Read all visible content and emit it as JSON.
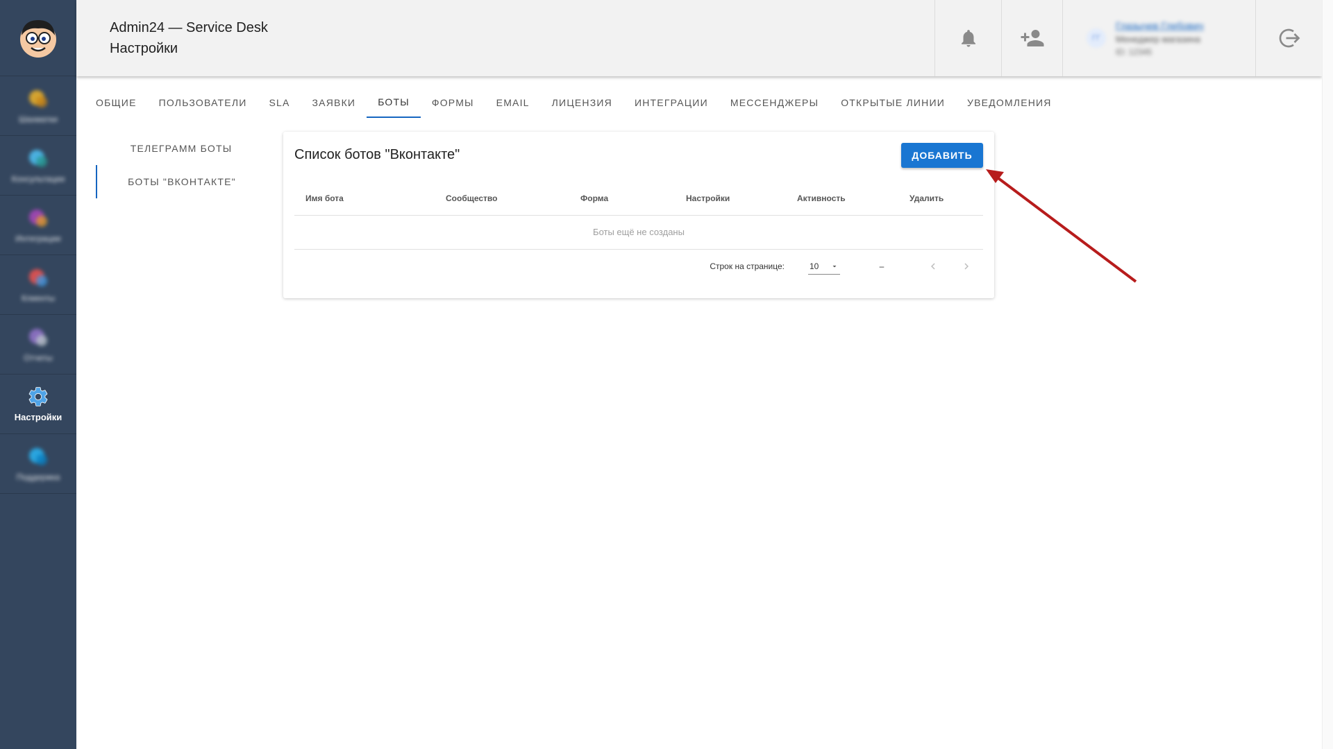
{
  "sidebar": {
    "items": [
      {
        "label": "Шахматки",
        "icon": "folder-icon",
        "blurred": true
      },
      {
        "label": "Консультации",
        "icon": "globe-icon",
        "blurred": true
      },
      {
        "label": "Интеграции",
        "icon": "network-icon",
        "blurred": true
      },
      {
        "label": "Клиенты",
        "icon": "users-icon",
        "blurred": true
      },
      {
        "label": "Отчеты",
        "icon": "report-icon",
        "blurred": true
      },
      {
        "label": "Настройки",
        "icon": "gear-icon",
        "active": true
      },
      {
        "label": "Поддержка",
        "icon": "support-icon",
        "blurred": true
      }
    ]
  },
  "header": {
    "app_title": "Admin24 — Service Desk",
    "page_title": "Настройки",
    "user": {
      "initials": "ГГ",
      "name": "Глазычев Глебович",
      "role": "Менеджер магазина",
      "id": "ID: 12345"
    }
  },
  "tabs": [
    {
      "label": "Общие"
    },
    {
      "label": "Пользователи"
    },
    {
      "label": "SLA"
    },
    {
      "label": "Заявки"
    },
    {
      "label": "Боты",
      "active": true
    },
    {
      "label": "Формы"
    },
    {
      "label": "Email"
    },
    {
      "label": "Лицензия"
    },
    {
      "label": "Интеграции"
    },
    {
      "label": "Мессенджеры"
    },
    {
      "label": "Открытые линии"
    },
    {
      "label": "Уведомления"
    }
  ],
  "subnav": [
    {
      "label": "Телеграмм боты"
    },
    {
      "label": "Боты \"Вконтакте\"",
      "active": true
    }
  ],
  "card": {
    "title": "Список ботов \"Вконтакте\"",
    "add_label": "ДОБАВИТЬ",
    "columns": [
      "Имя бота",
      "Сообщество",
      "Форма",
      "Настройки",
      "Активность",
      "Удалить"
    ],
    "empty_text": "Боты ещё не созданы",
    "pager": {
      "rows_per_page_label": "Строк на странице:",
      "rows_per_page_value": "10",
      "range": "–"
    }
  },
  "colors": {
    "sidebar": "#34465e",
    "accent": "#1976d2",
    "arrow": "#b71c1c"
  }
}
